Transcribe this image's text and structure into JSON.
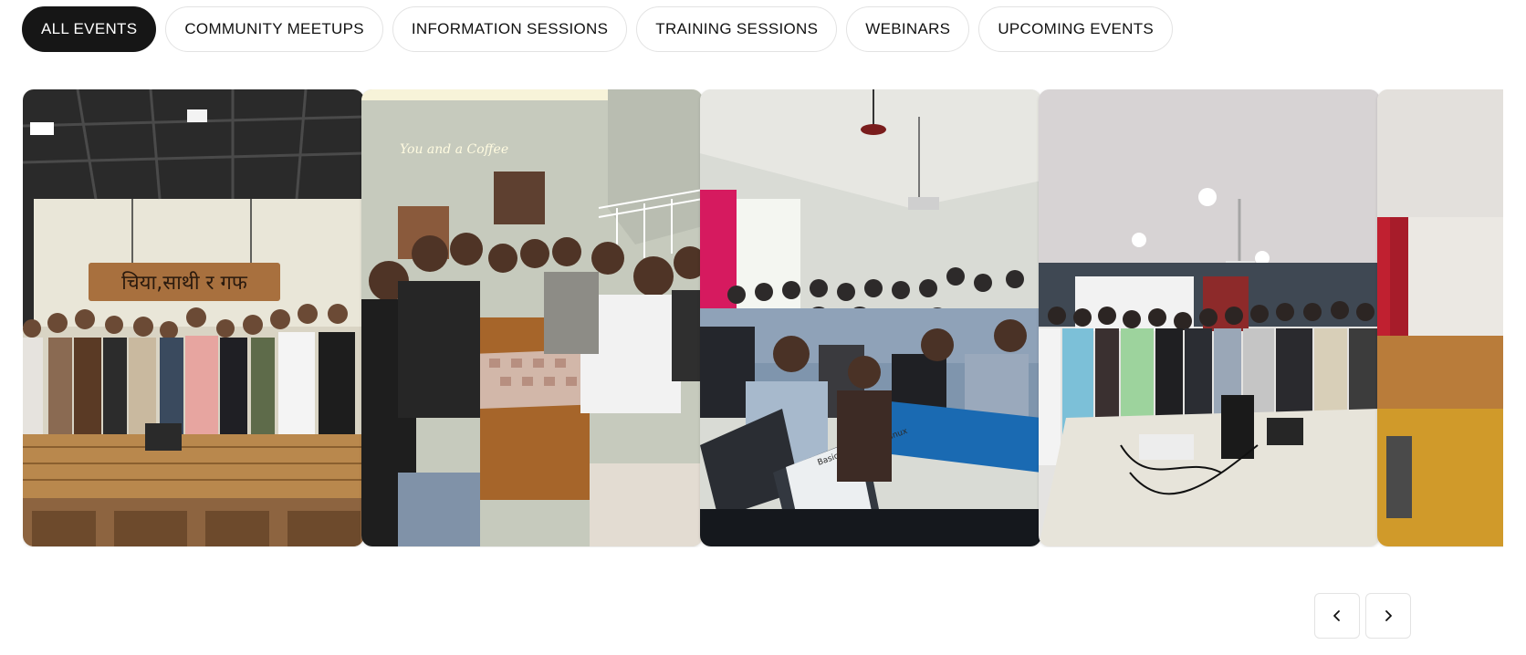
{
  "filters": [
    {
      "label": "ALL EVENTS",
      "active": true
    },
    {
      "label": "COMMUNITY MEETUPS",
      "active": false
    },
    {
      "label": "INFORMATION SESSIONS",
      "active": false
    },
    {
      "label": "TRAINING SESSIONS",
      "active": false
    },
    {
      "label": "WEBINARS",
      "active": false
    },
    {
      "label": "UPCOMING EVENTS",
      "active": false
    }
  ],
  "gallery": {
    "photos": [
      {
        "name": "event-photo-cafe-group",
        "sign_text": "चिया,साथी र गफ"
      },
      {
        "name": "event-photo-chess-table",
        "neon_text": "You and a Coffee"
      },
      {
        "name": "event-photo-classroom-laptops",
        "screen_text": "Basic Features of Linux"
      },
      {
        "name": "event-photo-projector-hall"
      },
      {
        "name": "event-photo-partial"
      }
    ]
  },
  "controls": {
    "prev_icon": "chevron-left-icon",
    "next_icon": "chevron-right-icon"
  },
  "colors": {
    "active_chip_bg": "#161616",
    "chip_border": "#e3e3e3"
  }
}
